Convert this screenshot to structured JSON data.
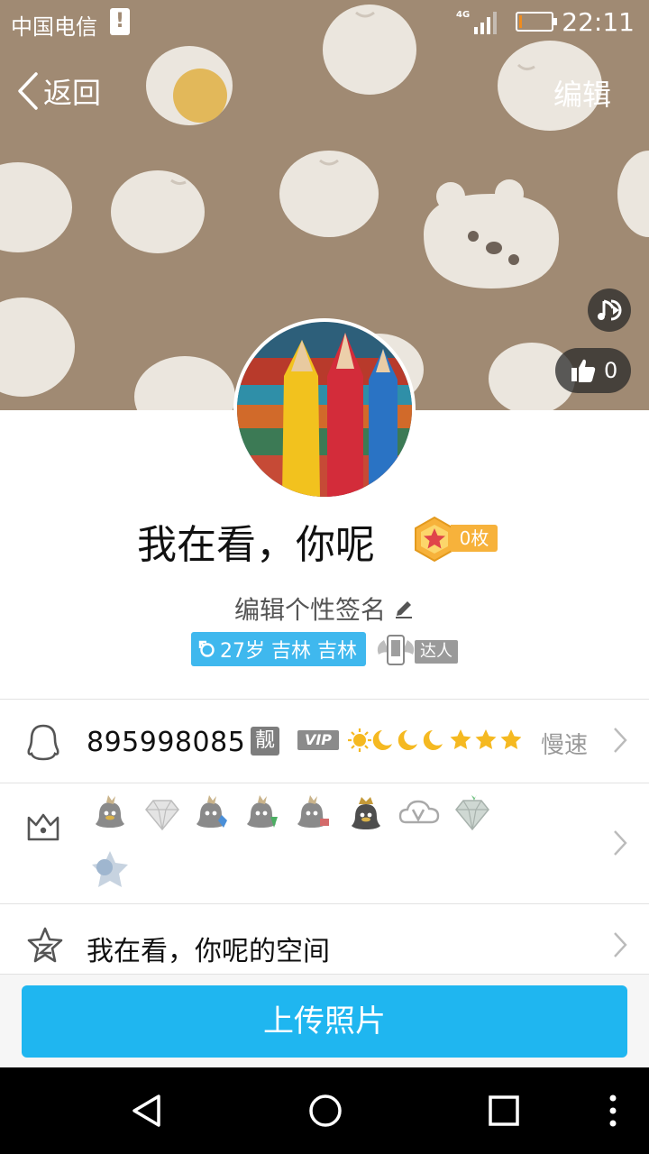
{
  "status_bar": {
    "carrier": "中国电信",
    "alert": "!",
    "network": "4G",
    "time": "22:11",
    "battery_level": 0.1
  },
  "header": {
    "back_label": "返回",
    "edit_label": "编辑"
  },
  "cover": {
    "like_count": "0"
  },
  "profile": {
    "nickname": "我在看，你呢",
    "medal_count": "0枚",
    "signature": "编辑个性签名",
    "age_location": "27岁 吉林 吉林",
    "daren_label": "达人"
  },
  "qq_row": {
    "number": "895998085",
    "liang_label": "靓",
    "vip_label": "VIP",
    "level_icons": [
      "sun-icon",
      "moon-icon",
      "moon-icon",
      "moon-icon",
      "star-icon",
      "star-icon",
      "star-icon"
    ],
    "speed_label": "慢速"
  },
  "badges_row": {
    "badge_icons": [
      "penguin-badge-icon",
      "diamond-badge-icon",
      "penguin-blue-badge-icon",
      "penguin-green-badge-icon",
      "penguin-gift-badge-icon",
      "penguin-crown-badge-icon",
      "cloud-v-badge-icon",
      "green-diamond-badge-icon",
      "blue-star-badge-icon"
    ]
  },
  "space_row": {
    "title": "我在看，你呢的空间"
  },
  "footer": {
    "upload_label": "上传照片"
  },
  "colors": {
    "accent": "#1fb6f0",
    "cover_bg": "#a08a73",
    "medal": "#f7b23b",
    "tag_blue": "#3fb8ee"
  }
}
